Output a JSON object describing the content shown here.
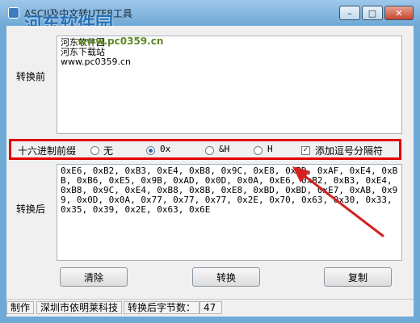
{
  "window": {
    "title": "ASCII及中文转UTF8工具",
    "controls": {
      "minimize": "–",
      "maximize": "□",
      "close": "✕"
    }
  },
  "watermark": {
    "site_name": "河东软件园",
    "url": "www.pc0359.cn"
  },
  "before_panel": {
    "label": "转换前",
    "text": "河东软件园\n河东下载站\nwww.pc0359.cn"
  },
  "options": {
    "label": "十六进制前缀",
    "radios": [
      {
        "label": "无",
        "checked": false
      },
      {
        "label": "0x",
        "checked": true
      },
      {
        "label": "&H",
        "checked": false
      },
      {
        "label": "H",
        "checked": false
      }
    ],
    "comma_checkbox": {
      "label": "添加逗号分隔符",
      "checked": true,
      "mark": "✓"
    }
  },
  "after_panel": {
    "label": "转换后",
    "text": "0xE6, 0xB2, 0xB3, 0xE4, 0xB8, 0x9C, 0xE8, 0xBD, 0xAF, 0xE4, 0xBB, 0xB6, 0xE5, 0x9B, 0xAD, 0x0D, 0x0A, 0xE6, 0xB2, 0xB3, 0xE4, 0xB8, 0x9C, 0xE4, 0xB8, 0x8B, 0xE8, 0xBD, 0xBD, 0xE7, 0xAB, 0x99, 0x0D, 0x0A, 0x77, 0x77, 0x77, 0x2E, 0x70, 0x63, 0x30, 0x33, 0x35, 0x39, 0x2E, 0x63, 0x6E"
  },
  "buttons": {
    "clear": "清除",
    "convert": "转换",
    "copy": "复制"
  },
  "status": {
    "maker_label": "制作",
    "maker_value": "深圳市依明莱科技",
    "bytes_label": "转换后字节数：",
    "bytes_value": "47"
  },
  "colors": {
    "highlight_box": "#e00000",
    "arrow": "#d32020",
    "titlebar": "#6fa9d6"
  }
}
